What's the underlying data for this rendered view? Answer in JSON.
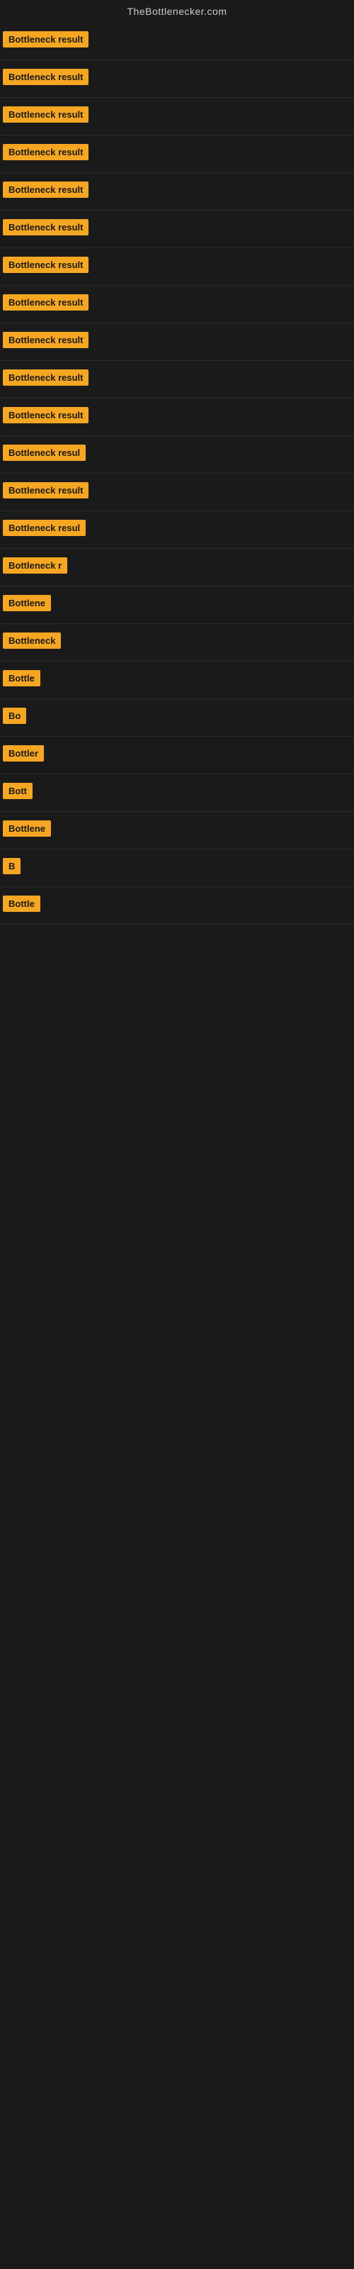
{
  "site": {
    "title": "TheBottlenecker.com"
  },
  "rows": [
    {
      "id": 1,
      "label": "Bottleneck result",
      "truncated": false
    },
    {
      "id": 2,
      "label": "Bottleneck result",
      "truncated": false
    },
    {
      "id": 3,
      "label": "Bottleneck result",
      "truncated": false
    },
    {
      "id": 4,
      "label": "Bottleneck result",
      "truncated": false
    },
    {
      "id": 5,
      "label": "Bottleneck result",
      "truncated": false
    },
    {
      "id": 6,
      "label": "Bottleneck result",
      "truncated": false
    },
    {
      "id": 7,
      "label": "Bottleneck result",
      "truncated": false
    },
    {
      "id": 8,
      "label": "Bottleneck result",
      "truncated": false
    },
    {
      "id": 9,
      "label": "Bottleneck result",
      "truncated": false
    },
    {
      "id": 10,
      "label": "Bottleneck result",
      "truncated": false
    },
    {
      "id": 11,
      "label": "Bottleneck result",
      "truncated": false
    },
    {
      "id": 12,
      "label": "Bottleneck resul",
      "truncated": true
    },
    {
      "id": 13,
      "label": "Bottleneck result",
      "truncated": false
    },
    {
      "id": 14,
      "label": "Bottleneck resul",
      "truncated": true
    },
    {
      "id": 15,
      "label": "Bottleneck r",
      "truncated": true
    },
    {
      "id": 16,
      "label": "Bottlene",
      "truncated": true
    },
    {
      "id": 17,
      "label": "Bottleneck",
      "truncated": true
    },
    {
      "id": 18,
      "label": "Bottle",
      "truncated": true
    },
    {
      "id": 19,
      "label": "Bo",
      "truncated": true
    },
    {
      "id": 20,
      "label": "Bottler",
      "truncated": true
    },
    {
      "id": 21,
      "label": "Bott",
      "truncated": true
    },
    {
      "id": 22,
      "label": "Bottlene",
      "truncated": true
    },
    {
      "id": 23,
      "label": "B",
      "truncated": true
    },
    {
      "id": 24,
      "label": "Bottle",
      "truncated": true
    }
  ],
  "colors": {
    "badge_bg": "#f5a623",
    "badge_text": "#1a1a1a",
    "bg": "#1a1a1a",
    "title": "#cccccc"
  }
}
